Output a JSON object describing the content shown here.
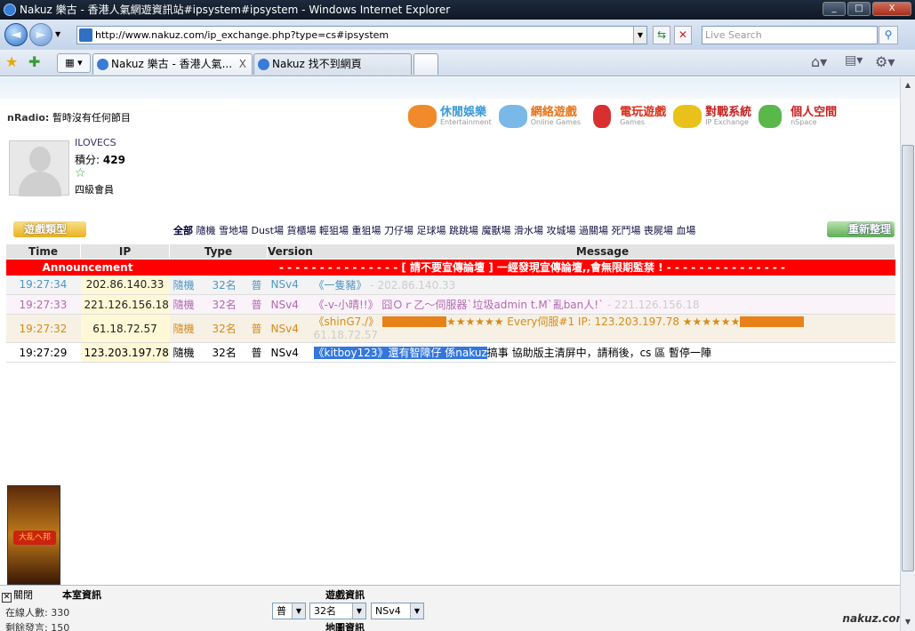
{
  "window": {
    "title": "Nakuz 樂古 - 香港人氣網遊資訊站#ipsystem#ipsystem - Windows Internet Explorer",
    "minimize": "_",
    "maximize": "□",
    "close": "X"
  },
  "nav": {
    "back": "◄",
    "forward": "►",
    "address": "http://www.nakuz.com/ip_exchange.php?type=cs#ipsystem",
    "search_placeholder": "Live Search"
  },
  "tabs": [
    {
      "label": "Nakuz 樂古 - 香港人氣...",
      "close": "X"
    },
    {
      "label": "Nakuz 找不到網頁"
    }
  ],
  "page": {
    "radio_label": "nRadio:",
    "radio_text": "暫時沒有任何節目",
    "menu": [
      {
        "t1": "休閒娛樂",
        "t2": "Entertainment",
        "color": "#e8681a"
      },
      {
        "t1": "網絡遊戲",
        "t2": "Online Games",
        "color": "#d8531a"
      },
      {
        "t1": "電玩遊戲",
        "t2": "Games",
        "color": "#d8301a"
      },
      {
        "t1": "對戰系統",
        "t2": "IP Exchange",
        "color": "#c82020"
      },
      {
        "t1": "個人空間",
        "t2": "nSpace",
        "color": "#c82020"
      }
    ],
    "user": {
      "name": "ILOVECS",
      "score_label": "積分:",
      "score": "429",
      "level": "四級會員"
    },
    "game_type_label": "遊戲類型",
    "game_all": "全部",
    "game_list": "隨機 雪地場 Dust場 貨櫃場 輕狙場 重狙場 刀仔場 足球場 跳跳場 魔獸場 滑水場 攻城場 過關場 死鬥場 喪屍場 血場",
    "refresh_label": "重新整理",
    "table": {
      "headers": [
        "Time",
        "IP",
        "Type",
        "Version",
        "Message"
      ],
      "announcement_label": "Announcement",
      "announcement_text": "- - - - - - - - - - - - - - - [ 請不要宣傳論壇 ] 一經發現宣傳論壇,,會無限期監禁 ! - - - - - - - - - - - - - - -",
      "rows": [
        {
          "time": "19:27:34",
          "ip": "202.86.140.33",
          "map": "隨機",
          "players": "32名",
          "mode": "普",
          "version": "NSv4",
          "name": "《一隻豬》",
          "msg": "",
          "trail": " - 202.86.140.33"
        },
        {
          "time": "19:27:33",
          "ip": "221.126.156.18",
          "map": "隨機",
          "players": "32名",
          "mode": "普",
          "version": "NSv4",
          "name": "《-v-小晴!!》",
          "msg": "囧Ｏｒ乙〜伺服器`垃圾admin t.M`亂ban人!`",
          "trail": " - 221.126.156.18"
        },
        {
          "time": "19:27:32",
          "ip": "61.18.72.57",
          "map": "隨機",
          "players": "32名",
          "mode": "普",
          "version": "NSv4",
          "name": "《shinG7./》",
          "msg": "★★★★★★ Every伺服#1 IP: 123.203.197.78 ★★★★★★",
          "trail": "61.18.72.57"
        },
        {
          "time": "19:27:29",
          "ip": "123.203.197.78",
          "map": "隨機",
          "players": "32名",
          "mode": "普",
          "version": "NSv4",
          "name": "《kitboy123》",
          "msg_hl": "還有智障仔 係nakuz",
          "msg": "搞事 協助版主清屏中，請稍後，cs 區 暫停一陣",
          "trail": ""
        }
      ]
    },
    "ad_seal": "大乱ヘ邦",
    "footer": {
      "close_label": "關閉",
      "room_info": "本室資訊",
      "online_label": "在線人數: 330",
      "remaining_label": "剩餘發言: 150",
      "game_info": "遊戲資訊",
      "map_info": "地圖資訊",
      "sel_mode": "普",
      "sel_players": "32名",
      "sel_version": "NSv4",
      "brand": "nakuz.com"
    }
  }
}
